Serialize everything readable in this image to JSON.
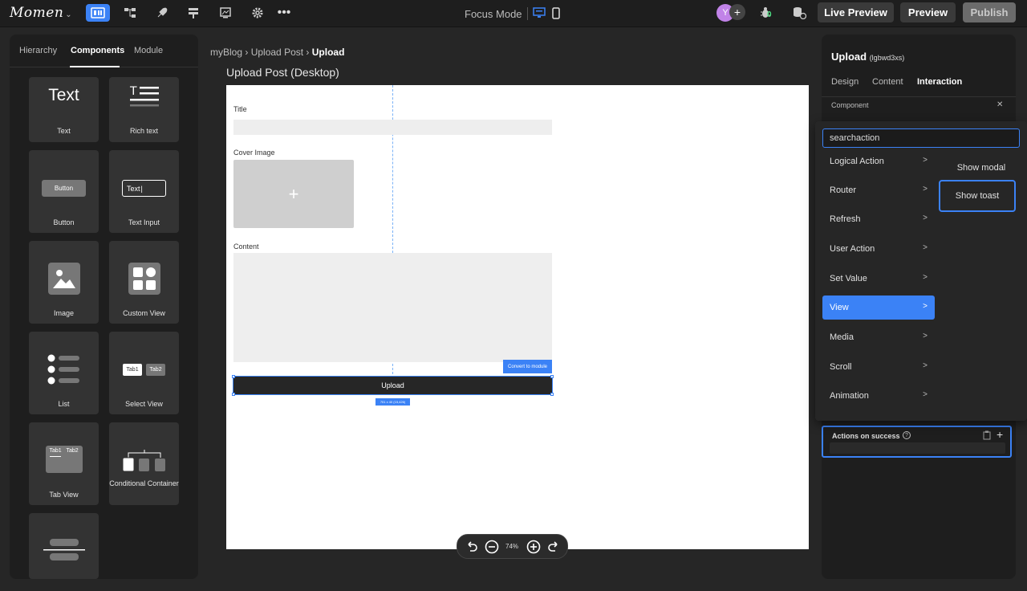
{
  "app": {
    "logo": "Momen",
    "focus_mode": "Focus Mode",
    "buttons": {
      "live_preview": "Live Preview",
      "preview": "Preview",
      "publish": "Publish"
    },
    "bug_count": "0",
    "avatar_initial": "Y"
  },
  "left_panel": {
    "tabs": [
      "Hierarchy",
      "Components",
      "Module"
    ],
    "active_tab": "Components",
    "components": [
      {
        "label": "Text",
        "icon": "text-icon",
        "icon_text": "Text"
      },
      {
        "label": "Rich text",
        "icon": "rich-text-icon"
      },
      {
        "label": "Button",
        "icon": "button-icon",
        "icon_text": "Button"
      },
      {
        "label": "Text Input",
        "icon": "text-input-icon",
        "icon_text": "Text"
      },
      {
        "label": "Image",
        "icon": "image-icon"
      },
      {
        "label": "Custom View",
        "icon": "custom-view-icon"
      },
      {
        "label": "List",
        "icon": "list-icon"
      },
      {
        "label": "Select View",
        "icon": "select-view-icon",
        "tab1": "Tab1",
        "tab2": "Tab2"
      },
      {
        "label": "Tab View",
        "icon": "tab-view-icon",
        "tab1": "Tab1",
        "tab2": "Tab2"
      },
      {
        "label": "Conditional Container",
        "icon": "conditional-container-icon"
      },
      {
        "label": "",
        "icon": "divider-component-icon"
      }
    ]
  },
  "center": {
    "breadcrumb": [
      "myBlog",
      "Upload Post",
      "Upload"
    ],
    "page_title": "Upload Post (Desktop)",
    "form": {
      "title_label": "Title",
      "cover_label": "Cover Image",
      "cover_plus": "+",
      "content_label": "Content",
      "convert_label": "Convert to module",
      "upload_label": "Upload",
      "size_tag": "701 x 40 (15,426)"
    },
    "zoom": "74%"
  },
  "right_panel": {
    "title": "Upload",
    "id": "(lgbwd3xs)",
    "tabs": [
      "Design",
      "Content",
      "Interaction"
    ],
    "active_tab": "Interaction",
    "component_label": "Component",
    "actions_on_success": "Actions on success",
    "help": "?",
    "add": "+"
  },
  "dropdown": {
    "search_value": "searchaction",
    "items": [
      "Logical Action",
      "Router",
      "Refresh",
      "User Action",
      "Set Value",
      "View",
      "Media",
      "Scroll",
      "Animation"
    ],
    "active_item": "View",
    "submenu": [
      "Show modal",
      "Show toast"
    ],
    "selected_sub": "Show toast",
    "arrow": ">"
  },
  "colors": {
    "accent": "#3b82f6",
    "bg": "#262626",
    "panel": "#1e1e1e"
  }
}
